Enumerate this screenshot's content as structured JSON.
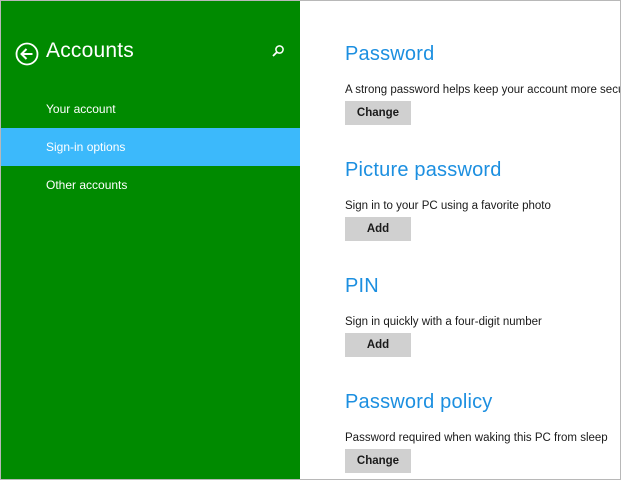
{
  "colors": {
    "sidebar_bg": "#008a00",
    "selected_bg": "#3cb9fb",
    "heading": "#1c8fe0",
    "button_bg": "#d0d0d0"
  },
  "sidebar": {
    "title": "Accounts",
    "back_icon": "back-arrow-icon",
    "search_icon": "search-icon",
    "items": [
      {
        "label": "Your account",
        "selected": false
      },
      {
        "label": "Sign-in options",
        "selected": true
      },
      {
        "label": "Other accounts",
        "selected": false
      }
    ]
  },
  "main": {
    "sections": [
      {
        "heading": "Password",
        "description": "A strong password helps keep your account more secure",
        "button": "Change"
      },
      {
        "heading": "Picture password",
        "description": "Sign in to your PC using a favorite photo",
        "button": "Add"
      },
      {
        "heading": "PIN",
        "description": "Sign in quickly with a four-digit number",
        "button": "Add"
      },
      {
        "heading": "Password policy",
        "description": "Password required when waking this PC from sleep",
        "button": "Change"
      }
    ]
  }
}
